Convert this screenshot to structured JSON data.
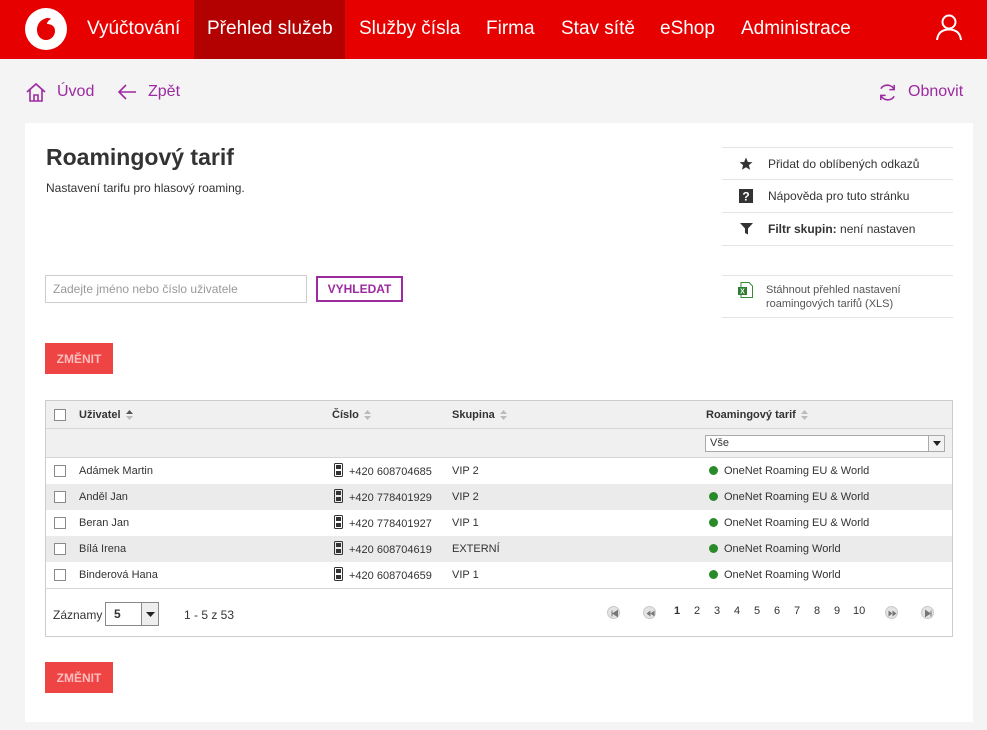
{
  "nav": {
    "items": [
      {
        "label": "Vyúčtování"
      },
      {
        "label": "Přehled služeb"
      },
      {
        "label": "Služby čísla"
      },
      {
        "label": "Firma"
      },
      {
        "label": "Stav sítě"
      },
      {
        "label": "eShop"
      },
      {
        "label": "Administrace"
      }
    ],
    "active": "Přehled služeb"
  },
  "subnav": {
    "home": "Úvod",
    "back": "Zpět",
    "refresh": "Obnovit"
  },
  "page": {
    "title": "Roamingový tarif",
    "subtitle": "Nastavení tarifu pro hlasový roaming."
  },
  "side": {
    "favorites": "Přidat do oblíbených odkazů",
    "help": "Nápověda pro tuto stránku",
    "filter_label": "Filtr skupin:",
    "filter_value": "není nastaven",
    "xls_line1": "Stáhnout přehled nastavení",
    "xls_line2": "roamingových tarifů (XLS)"
  },
  "search": {
    "placeholder": "Zadejte jméno nebo číslo uživatele",
    "button": "VYHLEDAT"
  },
  "actions": {
    "change": "ZMĚNIT"
  },
  "table": {
    "columns": {
      "user": "Uživatel",
      "number": "Číslo",
      "group": "Skupina",
      "tariff": "Roamingový tarif"
    },
    "tariff_filter": "Vše",
    "rows": [
      {
        "user": "Adámek Martin",
        "number": "+420 608704685",
        "group": "VIP 2",
        "tariff": "OneNet Roaming EU & World"
      },
      {
        "user": "Anděl Jan",
        "number": "+420 778401929",
        "group": "VIP 2",
        "tariff": "OneNet Roaming EU & World"
      },
      {
        "user": "Beran Jan",
        "number": "+420 778401927",
        "group": "VIP 1",
        "tariff": "OneNet Roaming EU & World"
      },
      {
        "user": "Bílá Irena",
        "number": "+420 608704619",
        "group": "EXTERNÍ",
        "tariff": "OneNet Roaming World"
      },
      {
        "user": "Binderová Hana",
        "number": "+420 608704659",
        "group": "VIP 1",
        "tariff": "OneNet Roaming World"
      }
    ]
  },
  "pager": {
    "records_label": "Záznamy",
    "page_size": "5",
    "range": "1 - 5 z 53",
    "pages": [
      "1",
      "2",
      "3",
      "4",
      "5",
      "6",
      "7",
      "8",
      "9",
      "10"
    ],
    "current_page": "1"
  }
}
